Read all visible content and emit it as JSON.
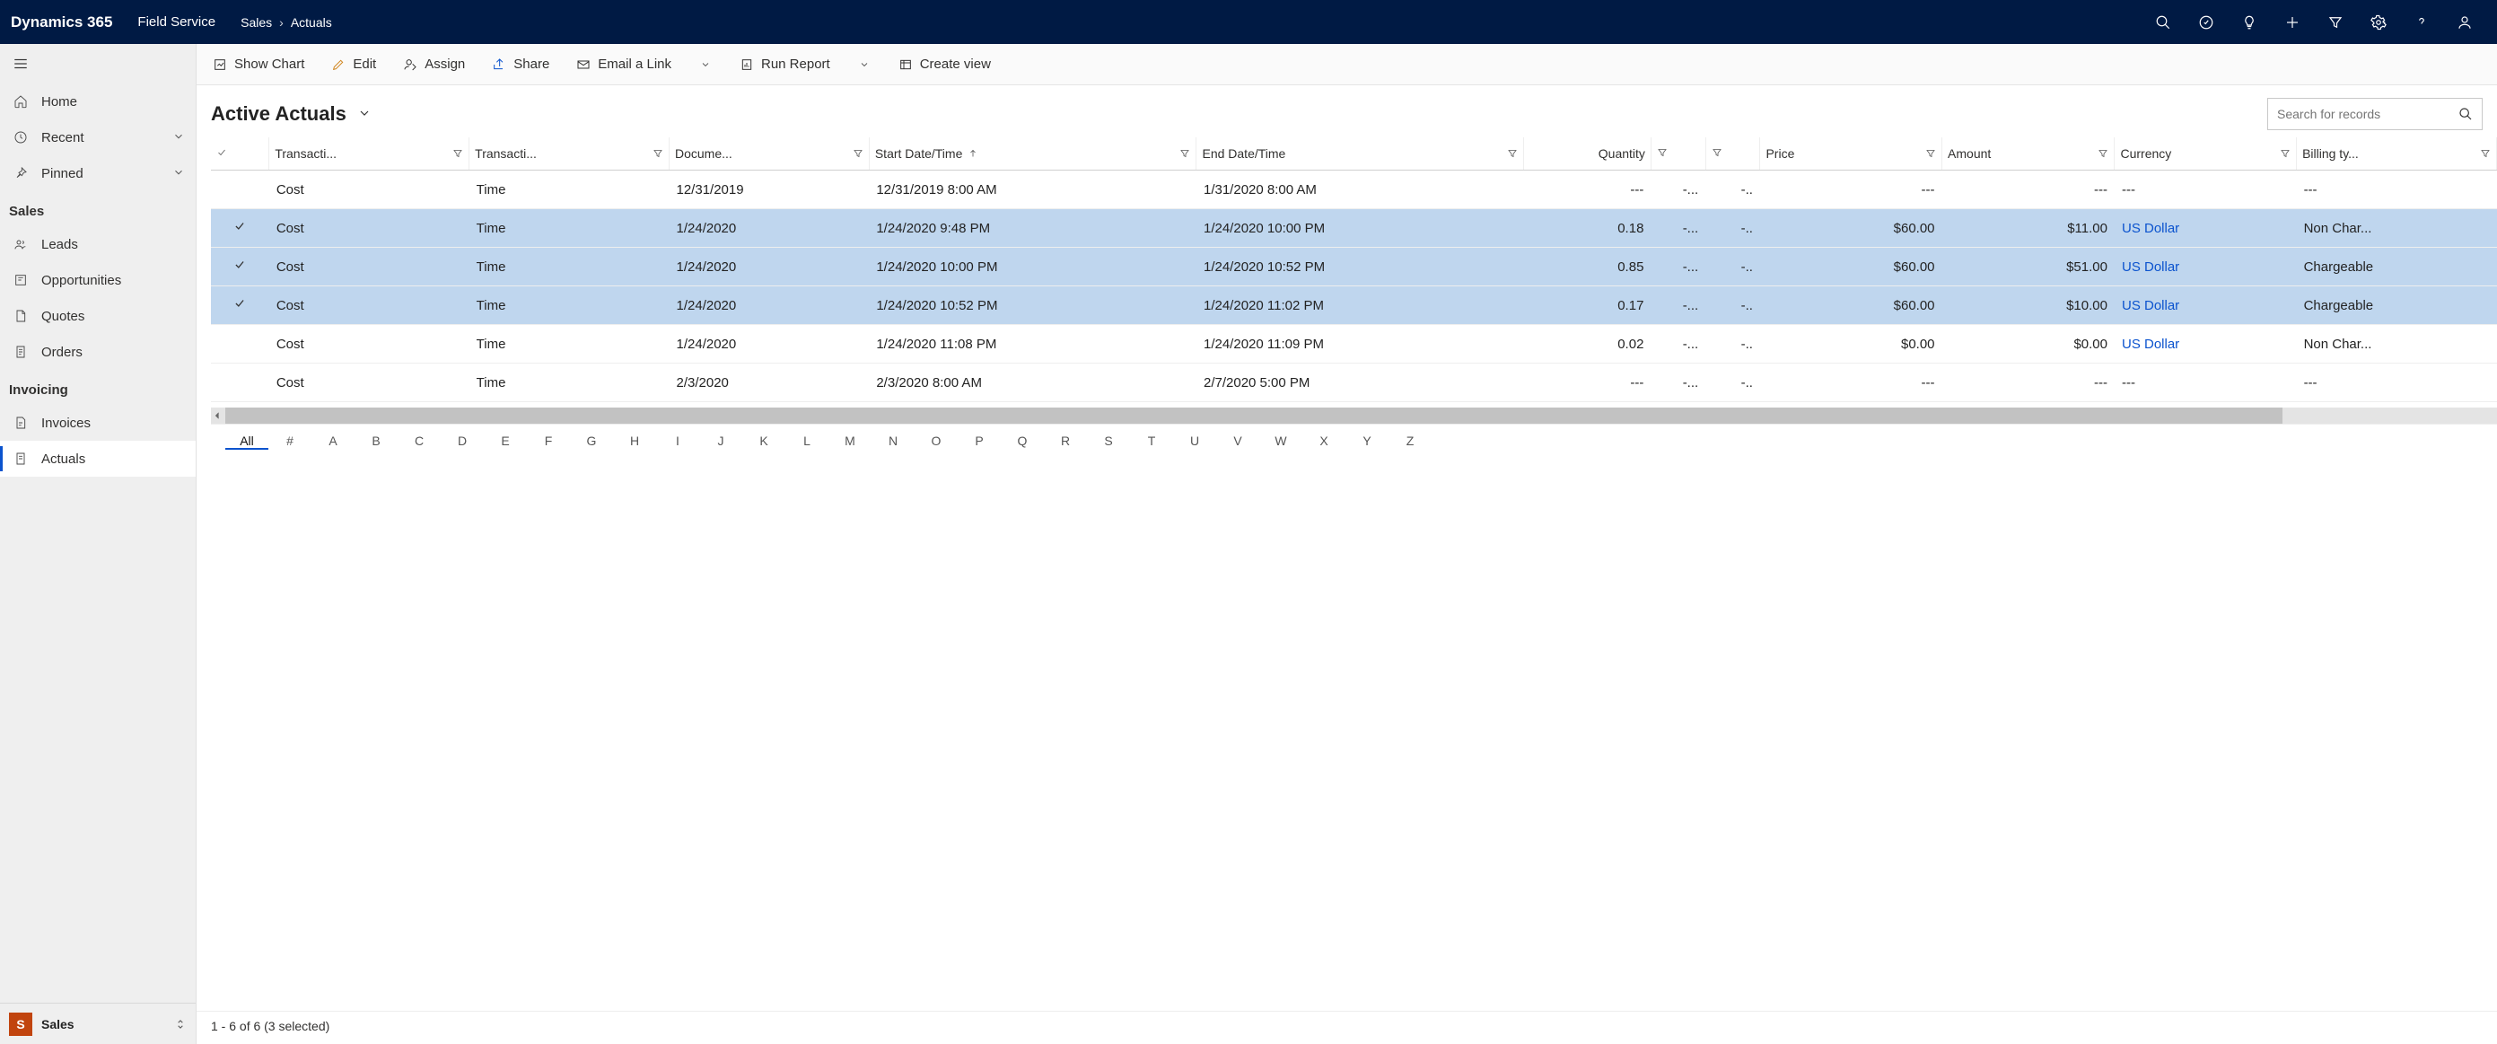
{
  "topbar": {
    "brand": "Dynamics 365",
    "module": "Field Service",
    "breadcrumbs": [
      "Sales",
      "Actuals"
    ]
  },
  "sidebar": {
    "items": [
      {
        "label": "Home",
        "icon": "home-icon"
      },
      {
        "label": "Recent",
        "icon": "clock-icon",
        "chevron": true
      },
      {
        "label": "Pinned",
        "icon": "pin-icon",
        "chevron": true
      }
    ],
    "sections": [
      {
        "title": "Sales",
        "items": [
          {
            "label": "Leads",
            "icon": "leads-icon"
          },
          {
            "label": "Opportunities",
            "icon": "opportunities-icon"
          },
          {
            "label": "Quotes",
            "icon": "quotes-icon"
          },
          {
            "label": "Orders",
            "icon": "orders-icon"
          }
        ]
      },
      {
        "title": "Invoicing",
        "items": [
          {
            "label": "Invoices",
            "icon": "invoices-icon"
          },
          {
            "label": "Actuals",
            "icon": "actuals-icon",
            "active": true
          }
        ]
      }
    ],
    "area": {
      "tile": "S",
      "label": "Sales"
    }
  },
  "commands": {
    "show_chart": "Show Chart",
    "edit": "Edit",
    "assign": "Assign",
    "share": "Share",
    "email_link": "Email a Link",
    "run_report": "Run Report",
    "create_view": "Create view"
  },
  "view_title": "Active Actuals",
  "search": {
    "placeholder": "Search for records"
  },
  "grid": {
    "columns": [
      "Transacti...",
      "Transacti...",
      "Docume...",
      "Start Date/Time",
      "End Date/Time",
      "Quantity",
      "Price",
      "Amount",
      "Currency",
      "Billing ty..."
    ],
    "rows": [
      {
        "selected": false,
        "c0": "Cost",
        "c1": "Time",
        "c2": "12/31/2019",
        "c3": "12/31/2019 8:00 AM",
        "c4": "1/31/2020 8:00 AM",
        "qty": "---",
        "q2": "-...",
        "q3": "-..",
        "price": "---",
        "amount": "---",
        "currency": "---",
        "billing": "---"
      },
      {
        "selected": true,
        "c0": "Cost",
        "c1": "Time",
        "c2": "1/24/2020",
        "c3": "1/24/2020 9:48 PM",
        "c4": "1/24/2020 10:00 PM",
        "qty": "0.18",
        "q2": "-...",
        "q3": "-..",
        "price": "$60.00",
        "amount": "$11.00",
        "currency": "US Dollar",
        "billing": "Non Char..."
      },
      {
        "selected": true,
        "c0": "Cost",
        "c1": "Time",
        "c2": "1/24/2020",
        "c3": "1/24/2020 10:00 PM",
        "c4": "1/24/2020 10:52 PM",
        "qty": "0.85",
        "q2": "-...",
        "q3": "-..",
        "price": "$60.00",
        "amount": "$51.00",
        "currency": "US Dollar",
        "billing": "Chargeable"
      },
      {
        "selected": true,
        "c0": "Cost",
        "c1": "Time",
        "c2": "1/24/2020",
        "c3": "1/24/2020 10:52 PM",
        "c4": "1/24/2020 11:02 PM",
        "qty": "0.17",
        "q2": "-...",
        "q3": "-..",
        "price": "$60.00",
        "amount": "$10.00",
        "currency": "US Dollar",
        "billing": "Chargeable"
      },
      {
        "selected": false,
        "c0": "Cost",
        "c1": "Time",
        "c2": "1/24/2020",
        "c3": "1/24/2020 11:08 PM",
        "c4": "1/24/2020 11:09 PM",
        "qty": "0.02",
        "q2": "-...",
        "q3": "-..",
        "price": "$0.00",
        "amount": "$0.00",
        "currency": "US Dollar",
        "billing": "Non Char..."
      },
      {
        "selected": false,
        "c0": "Cost",
        "c1": "Time",
        "c2": "2/3/2020",
        "c3": "2/3/2020 8:00 AM",
        "c4": "2/7/2020 5:00 PM",
        "qty": "---",
        "q2": "-...",
        "q3": "-..",
        "price": "---",
        "amount": "---",
        "currency": "---",
        "billing": "---"
      }
    ]
  },
  "jumpbar": [
    "All",
    "#",
    "A",
    "B",
    "C",
    "D",
    "E",
    "F",
    "G",
    "H",
    "I",
    "J",
    "K",
    "L",
    "M",
    "N",
    "O",
    "P",
    "Q",
    "R",
    "S",
    "T",
    "U",
    "V",
    "W",
    "X",
    "Y",
    "Z"
  ],
  "status": "1 - 6 of 6 (3 selected)"
}
